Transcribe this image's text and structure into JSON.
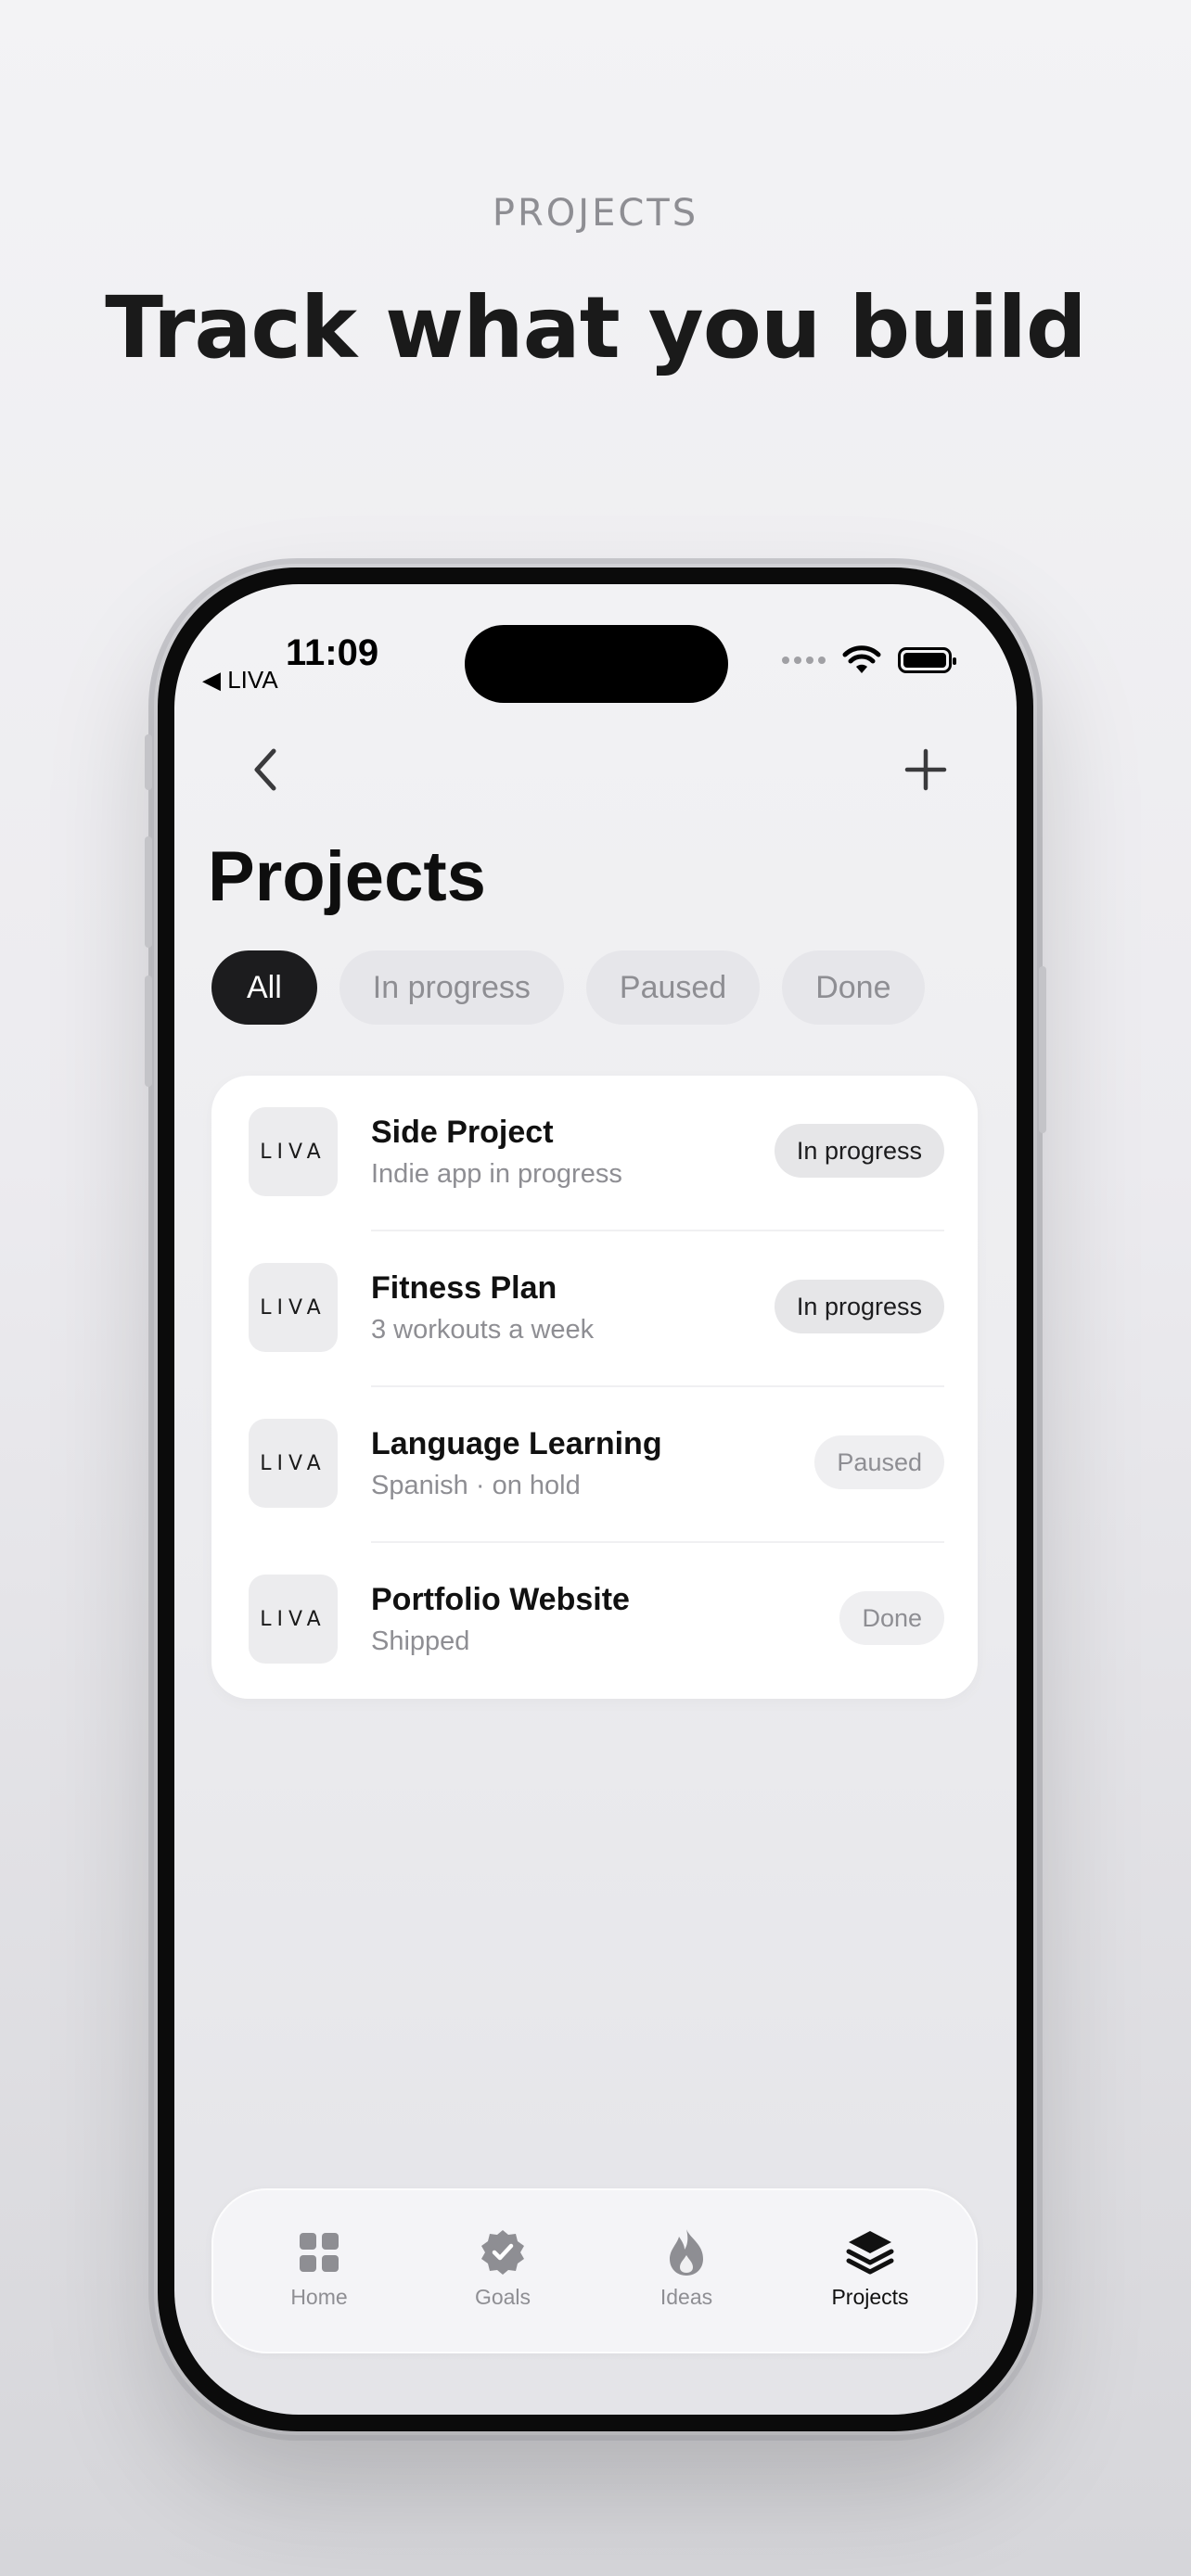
{
  "header": {
    "eyebrow": "PROJECTS",
    "headline": "Track what you build"
  },
  "status_bar": {
    "time": "11:09",
    "back_app": "◀ LIVA"
  },
  "nav": {
    "back_icon": "chevron-left-icon",
    "add_icon": "plus-icon"
  },
  "page": {
    "title": "Projects"
  },
  "filters": [
    {
      "label": "All",
      "active": true
    },
    {
      "label": "In progress",
      "active": false
    },
    {
      "label": "Paused",
      "active": false
    },
    {
      "label": "Done",
      "active": false
    }
  ],
  "projects": [
    {
      "logo": "LIVA",
      "title": "Side Project",
      "subtitle": "Indie app in progress",
      "status": "In progress"
    },
    {
      "logo": "LIVA",
      "title": "Fitness Plan",
      "subtitle": "3 workouts a week",
      "status": "In progress"
    },
    {
      "logo": "LIVA",
      "title": "Language Learning",
      "subtitle": "Spanish · on hold",
      "status": "Paused"
    },
    {
      "logo": "LIVA",
      "title": "Portfolio Website",
      "subtitle": "Shipped",
      "status": "Done"
    }
  ],
  "tabbar": [
    {
      "label": "Home",
      "icon": "grid-icon",
      "active": false
    },
    {
      "label": "Goals",
      "icon": "badge-check-icon",
      "active": false
    },
    {
      "label": "Ideas",
      "icon": "flame-icon",
      "active": false
    },
    {
      "label": "Projects",
      "icon": "layers-icon",
      "active": true
    }
  ],
  "colors": {
    "active_chip": "#1c1c1e",
    "muted_text": "#8e8e93",
    "card_bg": "#ffffff"
  }
}
